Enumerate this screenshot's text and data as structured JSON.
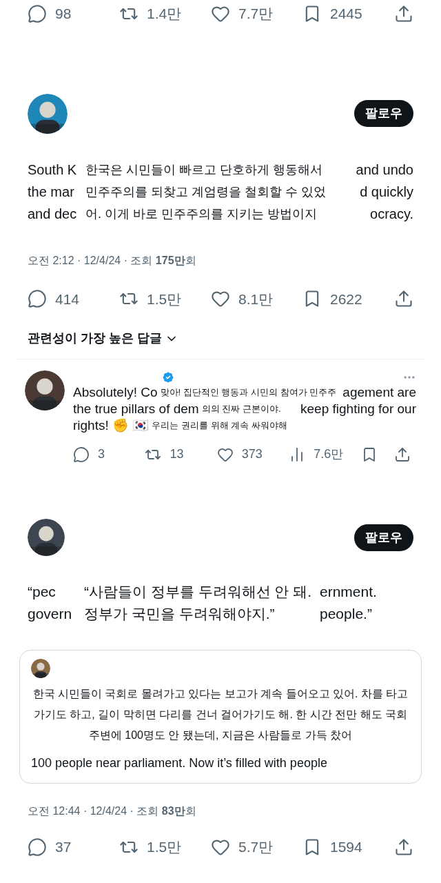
{
  "top_stats": [
    {
      "kind": "reply",
      "count": "98"
    },
    {
      "kind": "repost",
      "count": "1.4만"
    },
    {
      "kind": "like",
      "count": "7.7만"
    },
    {
      "kind": "bookmark",
      "count": "2445"
    },
    {
      "kind": "share"
    }
  ],
  "post": {
    "follow": "팔로우",
    "text_left": [
      "South K",
      "the mar",
      "and dec"
    ],
    "translation": "한국은 시민들이 빠르고 단호하게 행동해서 민주주의를 되찾고 계엄령을 철회할 수 있었어. 이게 바로 민주주의를 지키는 방법이지",
    "text_right": [
      "and undo",
      "d quickly",
      "ocracy."
    ],
    "meta": "오전 2:12 · 12/4/24 · 조회 **175만**회",
    "stats": [
      {
        "kind": "reply",
        "count": "414"
      },
      {
        "kind": "repost",
        "count": "1.5만"
      },
      {
        "kind": "like",
        "count": "8.1만"
      },
      {
        "kind": "bookmark",
        "count": "2622"
      },
      {
        "kind": "share"
      }
    ]
  },
  "replies_sort": "관련성이 가장 높은 답글",
  "reply": {
    "lines": [
      {
        "left": "Absolutely! Co",
        "translation": "맞아! 집단적인 행동과 시민의 참여가 민주주",
        "right": "agement are"
      },
      {
        "left": "the true pillars of dem",
        "translation": "의의 진짜 근본이야.",
        "right": "keep fighting for our"
      },
      {
        "left": "rights! ✊ 🇰🇷",
        "translation": "우리는 권리를 위해 계속 싸워야해"
      }
    ],
    "stats": [
      {
        "kind": "reply",
        "count": "3"
      },
      {
        "kind": "repost",
        "count": "13"
      },
      {
        "kind": "like",
        "count": "373"
      },
      {
        "kind": "views",
        "count": "7.6만"
      },
      {
        "kind": "bookmark"
      },
      {
        "kind": "share"
      }
    ]
  },
  "post2": {
    "follow": "팔로우",
    "lines": [
      {
        "left": "“pec",
        "translation": "“사람들이 정부를 두려워해선 안 돼.",
        "right": "ernment."
      },
      {
        "left": "govern",
        "translation": "정부가 국민을 두려워해야지.”",
        "right": "people.”"
      }
    ],
    "quote": {
      "translation": "한국 시민들이 국회로 몰려가고 있다는 보고가 계속 들어오고 있어. 차를 타고 가기도 하고, 길이 막히면 다리를 건너 걸어가기도 해. 한 시간 전만 해도 국회 주변에 100명도 안 됐는데, 지금은 사람들로 가득 찼어",
      "last_line": "100 people near parliament. Now it’s filled with people"
    },
    "meta": "오전 12:44 · 12/4/24 · 조회 **83만**회",
    "stats": [
      {
        "kind": "reply",
        "count": "37"
      },
      {
        "kind": "repost",
        "count": "1.5만"
      },
      {
        "kind": "like",
        "count": "5.7만"
      },
      {
        "kind": "bookmark",
        "count": "1594"
      },
      {
        "kind": "share"
      }
    ]
  }
}
